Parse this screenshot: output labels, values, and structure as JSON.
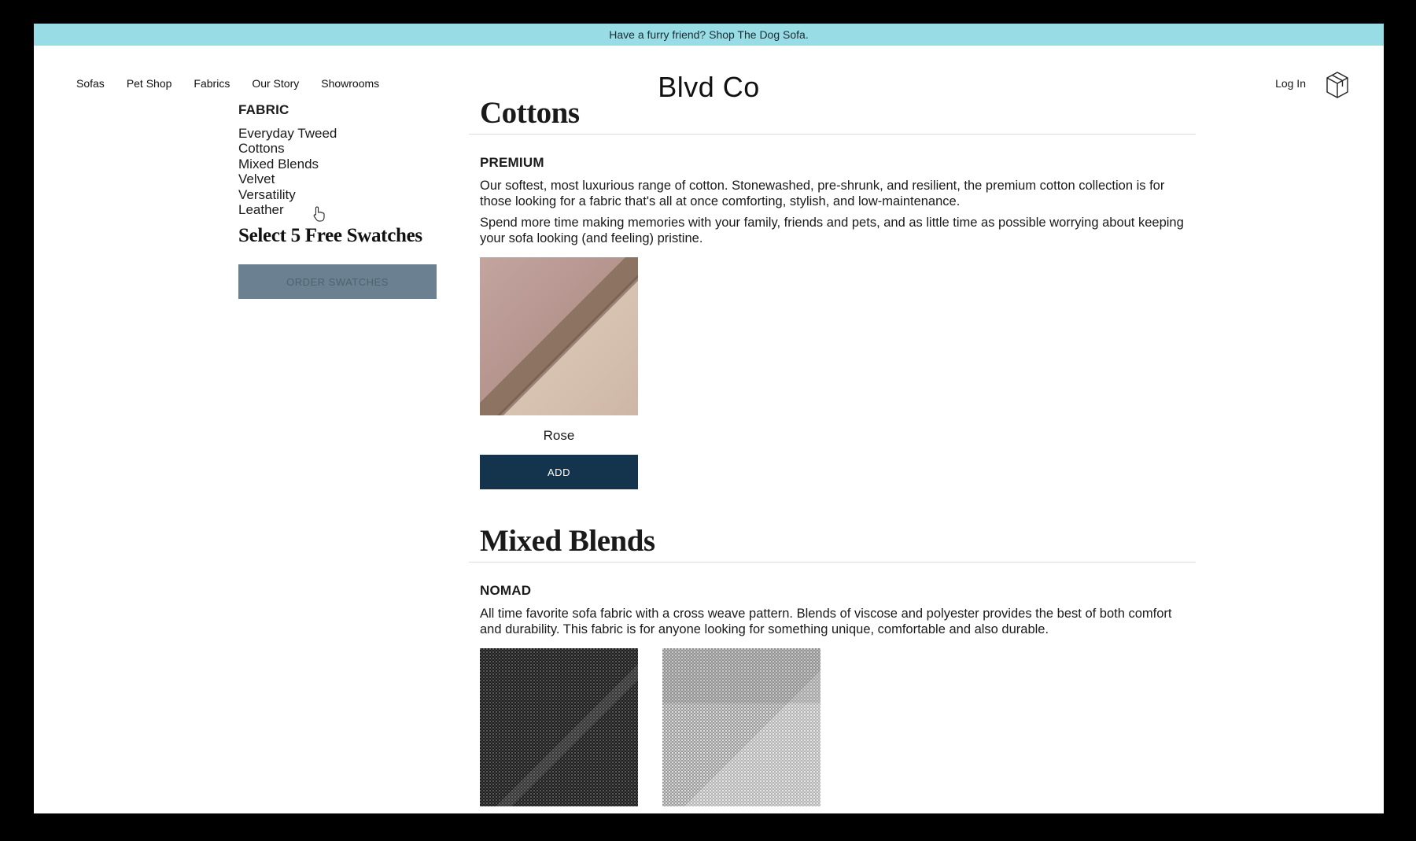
{
  "announcement": "Have a furry friend? Shop The Dog Sofa.",
  "nav": [
    "Sofas",
    "Pet Shop",
    "Fabrics",
    "Our Story",
    "Showrooms"
  ],
  "logo": "Blvd Co",
  "header": {
    "login": "Log In",
    "cart_icon": "box-cart-icon"
  },
  "sidebar": {
    "title": "FABRIC",
    "items": [
      "Everyday Tweed",
      "Cottons",
      "Mixed Blends",
      "Velvet",
      "Versatility",
      "Leather"
    ],
    "swatch_heading": "Select 5 Free Swatches",
    "order_button": "ORDER SWATCHES"
  },
  "sections": [
    {
      "title": "Cottons",
      "subtitle": "PREMIUM",
      "paragraphs": [
        "Our softest, most luxurious range of cotton. Stonewashed, pre-shrunk, and resilient, the premium cotton collection is for those looking for a fabric that's all at once comforting, stylish, and low-maintenance.",
        "Spend more time making memories with your family, friends and pets, and as little time as possible worrying about keeping your sofa looking (and feeling) pristine."
      ],
      "swatches": [
        {
          "name": "Rose",
          "button": "ADD"
        }
      ]
    },
    {
      "title": "Mixed Blends",
      "subtitle": "NOMAD",
      "paragraphs": [
        "All time favorite sofa fabric with a cross weave pattern. Blends of viscose and polyester provides the best of both comfort and durability. This fabric is for anyone looking for something unique, comfortable and also durable."
      ]
    }
  ],
  "colors": {
    "announcement_bg": "#98dde5",
    "add_button": "#13344c",
    "order_button": "#6b8191"
  }
}
